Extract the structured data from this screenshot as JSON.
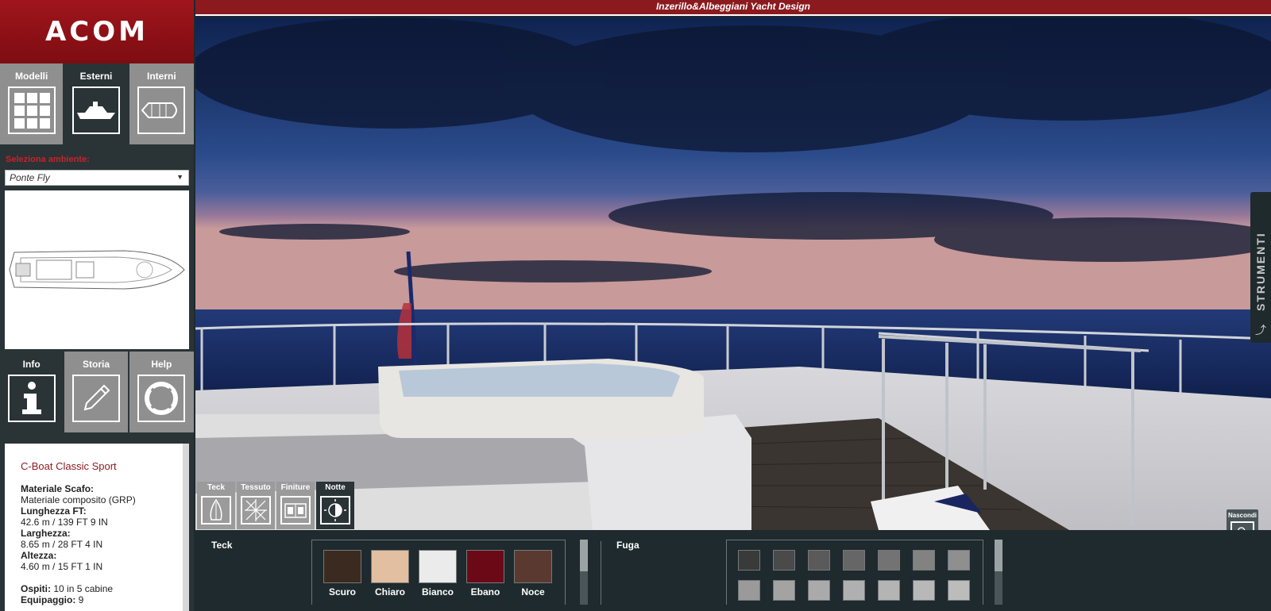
{
  "logo": "ACOM",
  "window_title": "Inzerillo&Albeggiani Yacht Design",
  "top_nav": {
    "items": [
      {
        "label": "Modelli",
        "icon": "grid-icon",
        "active": false
      },
      {
        "label": "Esterni",
        "icon": "yacht-exterior-icon",
        "active": true
      },
      {
        "label": "Interni",
        "icon": "yacht-interior-icon",
        "active": false
      }
    ]
  },
  "environment": {
    "label": "Seleziona ambiente:",
    "selected": "Ponte Fly"
  },
  "bottom_nav": {
    "items": [
      {
        "label": "Info",
        "icon": "info-icon",
        "active": true
      },
      {
        "label": "Storia",
        "icon": "pencil-icon",
        "active": false
      },
      {
        "label": "Help",
        "icon": "lifebuoy-icon",
        "active": false
      }
    ]
  },
  "info": {
    "model_name": "C-Boat Classic Sport",
    "hull_material_label": "Materiale Scafo:",
    "hull_material": "Materiale composito (GRP)",
    "length_label": "Lunghezza FT:",
    "length": "42.6 m / 139 FT 9 IN",
    "width_label": "Larghezza:",
    "width": "8.65 m / 28 FT 4 IN",
    "height_label": "Altezza:",
    "height": "4.60 m / 15 FT 1 IN",
    "guests_label": "Ospiti:",
    "guests": "10 in 5 cabine",
    "crew_label": "Equipaggio:",
    "crew": "9"
  },
  "tools": {
    "label": "STRUMENTI",
    "hide_label": "Nascondi"
  },
  "material_tabs": [
    {
      "label": "Teck",
      "icon": "teak-icon",
      "active": false
    },
    {
      "label": "Tessuto",
      "icon": "fabric-icon",
      "active": false
    },
    {
      "label": "Finiture",
      "icon": "finish-icon",
      "active": false
    },
    {
      "label": "Notte",
      "icon": "night-mode-icon",
      "active": true
    }
  ],
  "palette": {
    "teck_title": "Teck",
    "teck_swatches": [
      {
        "name": "Scuro",
        "color": "#3b2a1f"
      },
      {
        "name": "Chiaro",
        "color": "#e2bfa0"
      },
      {
        "name": "Bianco",
        "color": "#ebebeb"
      },
      {
        "name": "Ebano",
        "color": "#6b0a16"
      },
      {
        "name": "Noce",
        "color": "#5a3a30"
      }
    ],
    "fuga_title": "Fuga",
    "fuga_colors": [
      "#3a3a3a",
      "#4a4a4a",
      "#5a5a5a",
      "#666666",
      "#737373",
      "#828282",
      "#8f8f8f",
      "#9a9a9a",
      "#a3a3a3",
      "#aaaaaa",
      "#b0b0b0",
      "#b4b4b4",
      "#b8b8b8",
      "#bcbcbc"
    ]
  }
}
